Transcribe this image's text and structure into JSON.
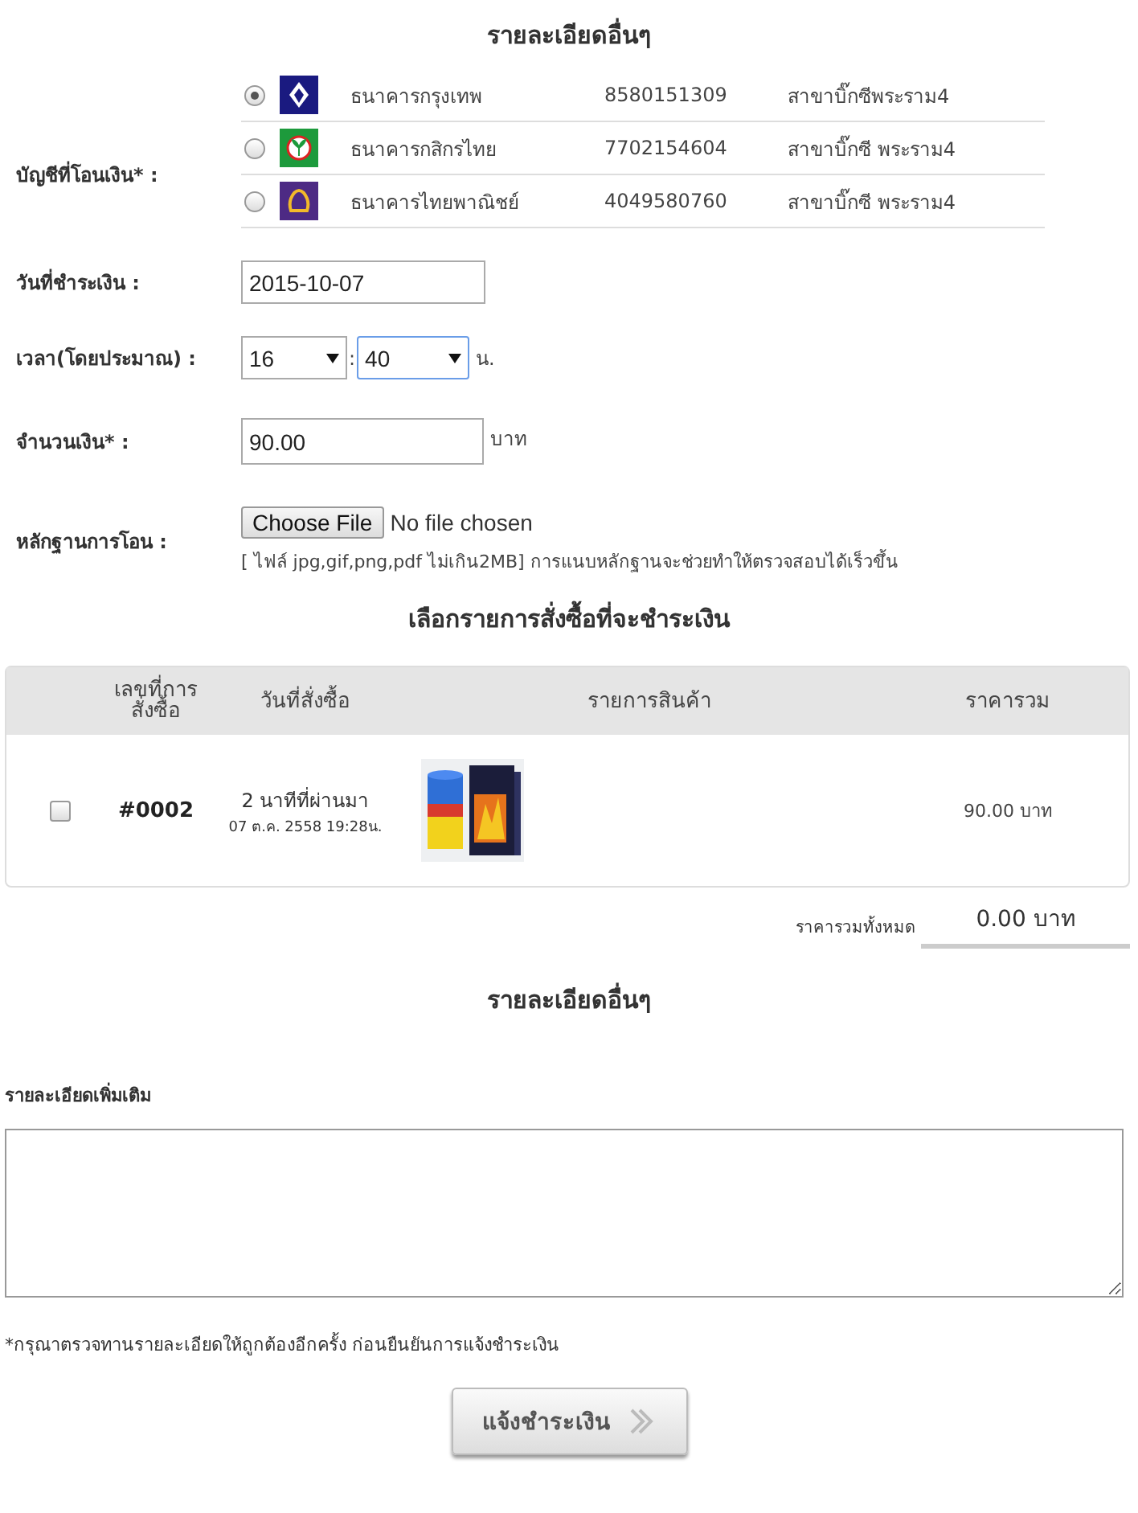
{
  "top_heading": "รายละเอียดอื่นๆ",
  "account_field": {
    "label": "บัญชีที่โอนเงิน* :",
    "banks": [
      {
        "kind": "lotus",
        "color": "#1a1a80",
        "name": "ธนาคารกรุงเทพ",
        "account": "8580151309",
        "branch": "สาขาบิ๊กซีพระราม4",
        "selected": true
      },
      {
        "kind": "leaf",
        "color": "#1d9a3c",
        "name": "ธนาคารกสิกรไทย",
        "account": "7702154604",
        "branch": "สาขาบิ๊กซี พระราม4",
        "selected": false
      },
      {
        "kind": "arch",
        "color": "#4d2a84",
        "name": "ธนาคารไทยพาณิชย์",
        "account": "4049580760",
        "branch": "สาขาบิ๊กซี พระราม4",
        "selected": false
      }
    ]
  },
  "date_field": {
    "label": "วันที่ชำระเงิน :",
    "value": "2015-10-07"
  },
  "time_field": {
    "label": "เวลา(โดยประมาณ) :",
    "hour": "16",
    "separator": ":",
    "minute": "40",
    "minute_focused": true,
    "unit": "น."
  },
  "amount_field": {
    "label": "จำนวนเงิน* :",
    "value": "90.00",
    "unit": "บาท"
  },
  "proof_field": {
    "label": "หลักฐานการโอน :",
    "button": "Choose File",
    "status": "No file chosen",
    "hint": "[ ไฟล์ jpg,gif,png,pdf ไม่เกิน2MB] การแนบหลักฐานจะช่วยทำให้ตรวจสอบได้เร็วขึ้น"
  },
  "orders_heading": "เลือกรายการสั่งซื้อที่จะชำระเงิน",
  "orders_table": {
    "columns": [
      "เลขที่การสั่งซื้อ",
      "วันที่สั่งซื้อ",
      "รายการสินค้า",
      "ราคารวม"
    ],
    "rows": [
      {
        "checked": false,
        "order_no": "#0002",
        "ago": "2 นาทีที่ผ่านมา",
        "date": "07 ต.ค. 2558 19:28น.",
        "price": "90.00 บาท"
      }
    ]
  },
  "total": {
    "label": "ราคารวมทั้งหมด",
    "value": "0.00 บาท"
  },
  "details_heading": "รายละเอียดอื่นๆ",
  "details_field": {
    "label": "รายละเอียดเพิ่มเติม"
  },
  "note": "*กรุณาตรวจทานรายละเอียดให้ถูกต้องอีกครั้ง ก่อนยืนยันการแจ้งชำระเงิน",
  "submit_button": "แจ้งชำระเงิน"
}
